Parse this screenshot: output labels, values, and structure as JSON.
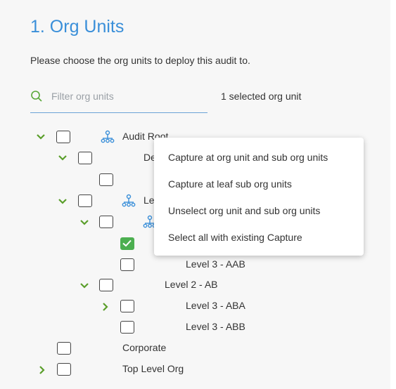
{
  "section": {
    "title": "1. Org Units",
    "subtitle": "Please choose the org units to deploy this audit to."
  },
  "filter": {
    "placeholder": "Filter org units",
    "selected_text": "1 selected org unit"
  },
  "tree": {
    "audit_root": "Audit Root",
    "de_partial": "De",
    "le_partial": "Le",
    "level3_aab": "Level 3 - AAB",
    "level2_ab": "Level 2 - AB",
    "level3_aba": "Level 3 - ABA",
    "level3_abb": "Level 3 - ABB",
    "corporate": "Corporate",
    "top_level_org": "Top Level Org"
  },
  "context_menu": {
    "items": [
      "Capture at org unit and sub org units",
      "Capture at leaf sub org units",
      "Unselect org unit and sub org units",
      "Select all with existing Capture"
    ]
  },
  "colors": {
    "accent_blue": "#3a8fd9",
    "check_green": "#4caf50",
    "chevron_green": "#5a9e2a"
  }
}
